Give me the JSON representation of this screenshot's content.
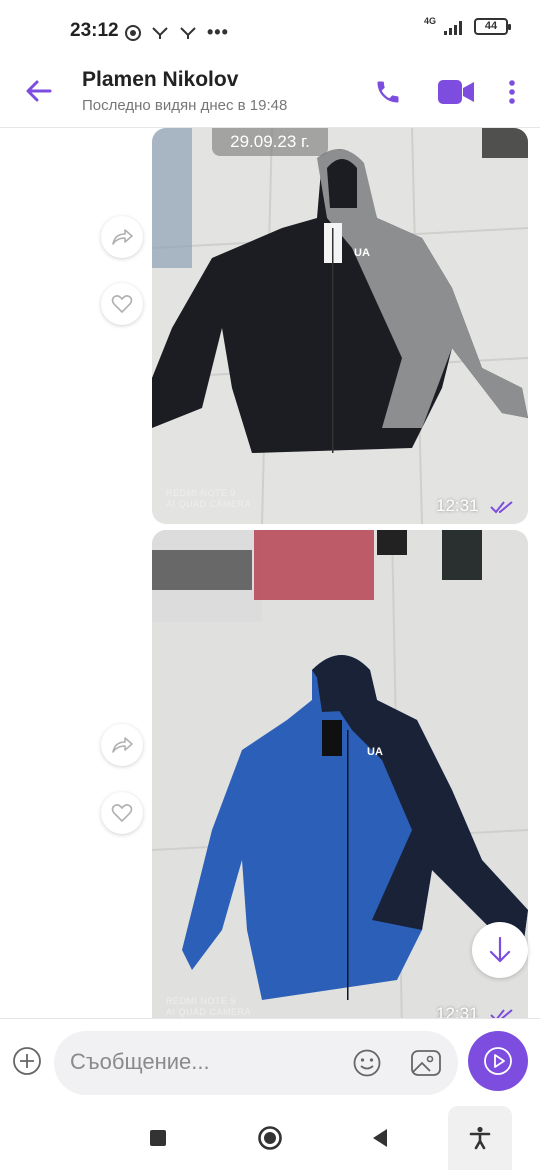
{
  "status_bar": {
    "time": "23:12",
    "battery": "44",
    "network": "4G"
  },
  "header": {
    "contact_name": "Plamen Nikolov",
    "last_seen": "Последно видян днес в 19:48",
    "accent_color": "#7c4dde"
  },
  "chat": {
    "date_chip": "29.09.23 г.",
    "messages": [
      {
        "type": "photo",
        "subject": "grey-black-hooded-jacket",
        "time": "12:31",
        "watermark_line1": "REDMI NOTE 9",
        "watermark_line2": "AI QUAD CAMERA",
        "status": "read"
      },
      {
        "type": "photo",
        "subject": "blue-navy-hooded-jacket",
        "time": "12:31",
        "watermark_line1": "REDMI NOTE 9",
        "watermark_line2": "AI QUAD CAMERA",
        "status": "read"
      }
    ]
  },
  "composer": {
    "placeholder": "Съобщение..."
  },
  "icons": {
    "back": "arrow-left-icon",
    "call": "phone-icon",
    "video": "video-camera-icon",
    "more": "kebab-menu-icon",
    "forward": "share-arrow-icon",
    "like": "heart-icon",
    "scroll": "arrow-down-icon",
    "attach": "plus-circle-icon",
    "sticker": "smiley-icon",
    "gallery": "image-icon",
    "send": "play-icon"
  }
}
